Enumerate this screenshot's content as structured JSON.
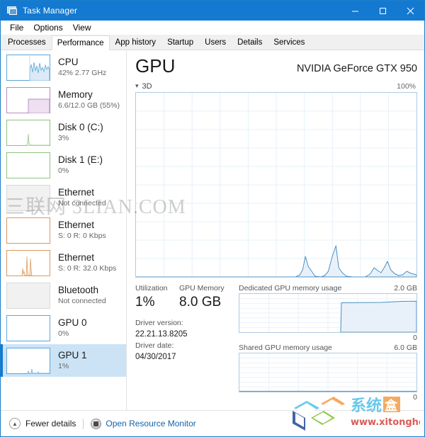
{
  "window": {
    "title": "Task Manager",
    "icon": "task-manager-icon",
    "controls": {
      "minimize": "–",
      "maximize": "□",
      "close": "✕"
    }
  },
  "menu": {
    "items": [
      "File",
      "Options",
      "View"
    ]
  },
  "tabs": {
    "active": "Performance",
    "items": [
      "Processes",
      "Performance",
      "App history",
      "Startup",
      "Users",
      "Details",
      "Services"
    ]
  },
  "sidebar": {
    "items": [
      {
        "name": "CPU",
        "sub": "42%  2.77 GHz",
        "accent": "#5ea5d9",
        "selected": false
      },
      {
        "name": "Memory",
        "sub": "6.6/12.0 GB (55%)",
        "accent": "#b48cc0",
        "selected": false
      },
      {
        "name": "Disk 0 (C:)",
        "sub": "3%",
        "accent": "#8ec37e",
        "selected": false
      },
      {
        "name": "Disk 1 (E:)",
        "sub": "0%",
        "accent": "#8ec37e",
        "selected": false
      },
      {
        "name": "Ethernet",
        "sub": "Not connected",
        "accent": "#cccccc",
        "selected": false
      },
      {
        "name": "Ethernet",
        "sub": "S: 0  R: 0 Kbps",
        "accent": "#d79a5b",
        "selected": false
      },
      {
        "name": "Ethernet",
        "sub": "S: 0  R: 32.0 Kbps",
        "accent": "#d79a5b",
        "selected": false
      },
      {
        "name": "Bluetooth",
        "sub": "Not connected",
        "accent": "#cccccc",
        "selected": false
      },
      {
        "name": "GPU 0",
        "sub": "0%",
        "accent": "#5ea5d9",
        "selected": false
      },
      {
        "name": "GPU 1",
        "sub": "1%",
        "accent": "#5ea5d9",
        "selected": true
      }
    ]
  },
  "main": {
    "title": "GPU",
    "model": "NVIDIA GeForce GTX 950",
    "engine_label": "3D",
    "engine_max": "100%",
    "stats": {
      "utilization_label": "Utilization",
      "utilization_value": "1%",
      "memory_label": "GPU Memory",
      "memory_value": "8.0 GB",
      "driver_version_label": "Driver version:",
      "driver_version_value": "22.21.13.8205",
      "driver_date_label": "Driver date:",
      "driver_date_value": "04/30/2017"
    },
    "dedicated": {
      "label": "Dedicated GPU memory usage",
      "max": "2.0 GB",
      "min": "0"
    },
    "shared": {
      "label": "Shared GPU memory usage",
      "max": "6.0 GB",
      "min": "0"
    }
  },
  "footer": {
    "fewer_details": "Fewer details",
    "open_resource_monitor": "Open Resource Monitor"
  },
  "watermarks": {
    "text": "三联网 3LIAN.COM",
    "logo_title": "系统盒",
    "logo_url": "www.xitonghe.com"
  },
  "chart_data": [
    {
      "type": "area",
      "title": "3D",
      "ylabel": "",
      "xlabel": "",
      "ylim": [
        0,
        100
      ],
      "grid": true,
      "values": [
        0,
        0,
        0,
        0,
        0,
        0,
        0,
        0,
        0,
        0,
        0,
        0,
        0,
        0,
        0,
        0,
        0,
        0,
        0,
        0,
        0,
        0,
        0,
        0,
        0,
        0,
        0,
        0,
        0,
        0,
        0,
        0,
        0,
        0,
        0,
        0,
        0,
        0,
        0,
        0,
        0,
        0,
        0,
        0,
        0,
        0,
        0,
        0,
        0,
        0,
        0,
        0,
        0,
        0,
        0,
        0,
        1,
        3,
        11,
        6,
        2,
        1,
        0,
        0,
        0,
        1,
        2,
        6,
        20,
        8,
        3,
        1,
        1,
        0,
        0,
        0,
        0,
        0,
        0,
        1,
        3,
        6,
        3,
        2,
        4,
        7,
        3,
        1
      ]
    },
    {
      "type": "area",
      "title": "Dedicated GPU memory usage",
      "ylim": [
        0,
        2.0
      ],
      "unit": "GB",
      "grid": true,
      "values": [
        0,
        0,
        0,
        0,
        0,
        0,
        0,
        0,
        0,
        0,
        0,
        0,
        0,
        0,
        0,
        0,
        0,
        0,
        0,
        0,
        0,
        0,
        0,
        0,
        0,
        0,
        0,
        0,
        0,
        0,
        0,
        0,
        0,
        0,
        0,
        0,
        0,
        0,
        0,
        0,
        0,
        0,
        0,
        0,
        0,
        0,
        0,
        0,
        0,
        0,
        1.58,
        1.62,
        1.62,
        1.62,
        1.62,
        1.62,
        1.62,
        1.62,
        1.62,
        1.62,
        1.62,
        1.62,
        1.62,
        1.62,
        1.62,
        1.62,
        1.62,
        1.62,
        1.63,
        1.64,
        1.65,
        1.66,
        1.67,
        1.68,
        1.69,
        1.7,
        1.7,
        1.7,
        1.7,
        1.7,
        1.7,
        1.7,
        1.7,
        1.7,
        1.7,
        1.7,
        1.7,
        1.7
      ]
    },
    {
      "type": "area",
      "title": "Shared GPU memory usage",
      "ylim": [
        0,
        6.0
      ],
      "unit": "GB",
      "grid": true,
      "values": [
        0,
        0,
        0,
        0,
        0,
        0,
        0,
        0,
        0,
        0,
        0,
        0,
        0,
        0,
        0,
        0,
        0,
        0,
        0,
        0,
        0,
        0,
        0,
        0,
        0,
        0,
        0,
        0,
        0,
        0,
        0,
        0,
        0,
        0,
        0,
        0,
        0,
        0,
        0,
        0,
        0,
        0,
        0,
        0,
        0,
        0,
        0,
        0,
        0,
        0,
        0,
        0,
        0,
        0,
        0,
        0,
        0,
        0,
        0,
        0,
        0,
        0,
        0,
        0,
        0,
        0,
        0,
        0,
        0,
        0,
        0,
        0,
        0,
        0,
        0,
        0,
        0,
        0,
        0,
        0,
        0,
        0,
        0,
        0,
        0,
        0,
        0,
        0
      ]
    }
  ]
}
